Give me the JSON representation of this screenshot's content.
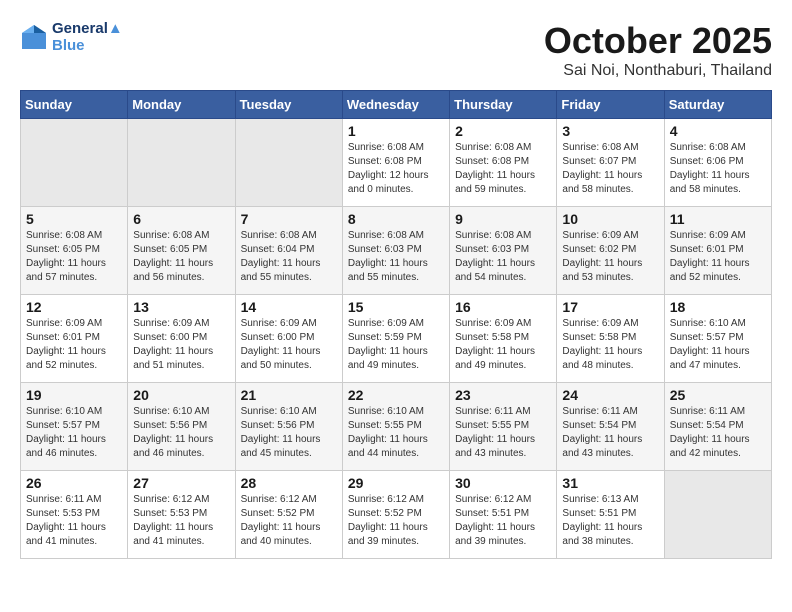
{
  "header": {
    "logo_line1": "General",
    "logo_line2": "Blue",
    "month": "October 2025",
    "location": "Sai Noi, Nonthaburi, Thailand"
  },
  "weekdays": [
    "Sunday",
    "Monday",
    "Tuesday",
    "Wednesday",
    "Thursday",
    "Friday",
    "Saturday"
  ],
  "weeks": [
    [
      {
        "day": "",
        "info": ""
      },
      {
        "day": "",
        "info": ""
      },
      {
        "day": "",
        "info": ""
      },
      {
        "day": "1",
        "info": "Sunrise: 6:08 AM\nSunset: 6:08 PM\nDaylight: 12 hours\nand 0 minutes."
      },
      {
        "day": "2",
        "info": "Sunrise: 6:08 AM\nSunset: 6:08 PM\nDaylight: 11 hours\nand 59 minutes."
      },
      {
        "day": "3",
        "info": "Sunrise: 6:08 AM\nSunset: 6:07 PM\nDaylight: 11 hours\nand 58 minutes."
      },
      {
        "day": "4",
        "info": "Sunrise: 6:08 AM\nSunset: 6:06 PM\nDaylight: 11 hours\nand 58 minutes."
      }
    ],
    [
      {
        "day": "5",
        "info": "Sunrise: 6:08 AM\nSunset: 6:05 PM\nDaylight: 11 hours\nand 57 minutes."
      },
      {
        "day": "6",
        "info": "Sunrise: 6:08 AM\nSunset: 6:05 PM\nDaylight: 11 hours\nand 56 minutes."
      },
      {
        "day": "7",
        "info": "Sunrise: 6:08 AM\nSunset: 6:04 PM\nDaylight: 11 hours\nand 55 minutes."
      },
      {
        "day": "8",
        "info": "Sunrise: 6:08 AM\nSunset: 6:03 PM\nDaylight: 11 hours\nand 55 minutes."
      },
      {
        "day": "9",
        "info": "Sunrise: 6:08 AM\nSunset: 6:03 PM\nDaylight: 11 hours\nand 54 minutes."
      },
      {
        "day": "10",
        "info": "Sunrise: 6:09 AM\nSunset: 6:02 PM\nDaylight: 11 hours\nand 53 minutes."
      },
      {
        "day": "11",
        "info": "Sunrise: 6:09 AM\nSunset: 6:01 PM\nDaylight: 11 hours\nand 52 minutes."
      }
    ],
    [
      {
        "day": "12",
        "info": "Sunrise: 6:09 AM\nSunset: 6:01 PM\nDaylight: 11 hours\nand 52 minutes."
      },
      {
        "day": "13",
        "info": "Sunrise: 6:09 AM\nSunset: 6:00 PM\nDaylight: 11 hours\nand 51 minutes."
      },
      {
        "day": "14",
        "info": "Sunrise: 6:09 AM\nSunset: 6:00 PM\nDaylight: 11 hours\nand 50 minutes."
      },
      {
        "day": "15",
        "info": "Sunrise: 6:09 AM\nSunset: 5:59 PM\nDaylight: 11 hours\nand 49 minutes."
      },
      {
        "day": "16",
        "info": "Sunrise: 6:09 AM\nSunset: 5:58 PM\nDaylight: 11 hours\nand 49 minutes."
      },
      {
        "day": "17",
        "info": "Sunrise: 6:09 AM\nSunset: 5:58 PM\nDaylight: 11 hours\nand 48 minutes."
      },
      {
        "day": "18",
        "info": "Sunrise: 6:10 AM\nSunset: 5:57 PM\nDaylight: 11 hours\nand 47 minutes."
      }
    ],
    [
      {
        "day": "19",
        "info": "Sunrise: 6:10 AM\nSunset: 5:57 PM\nDaylight: 11 hours\nand 46 minutes."
      },
      {
        "day": "20",
        "info": "Sunrise: 6:10 AM\nSunset: 5:56 PM\nDaylight: 11 hours\nand 46 minutes."
      },
      {
        "day": "21",
        "info": "Sunrise: 6:10 AM\nSunset: 5:56 PM\nDaylight: 11 hours\nand 45 minutes."
      },
      {
        "day": "22",
        "info": "Sunrise: 6:10 AM\nSunset: 5:55 PM\nDaylight: 11 hours\nand 44 minutes."
      },
      {
        "day": "23",
        "info": "Sunrise: 6:11 AM\nSunset: 5:55 PM\nDaylight: 11 hours\nand 43 minutes."
      },
      {
        "day": "24",
        "info": "Sunrise: 6:11 AM\nSunset: 5:54 PM\nDaylight: 11 hours\nand 43 minutes."
      },
      {
        "day": "25",
        "info": "Sunrise: 6:11 AM\nSunset: 5:54 PM\nDaylight: 11 hours\nand 42 minutes."
      }
    ],
    [
      {
        "day": "26",
        "info": "Sunrise: 6:11 AM\nSunset: 5:53 PM\nDaylight: 11 hours\nand 41 minutes."
      },
      {
        "day": "27",
        "info": "Sunrise: 6:12 AM\nSunset: 5:53 PM\nDaylight: 11 hours\nand 41 minutes."
      },
      {
        "day": "28",
        "info": "Sunrise: 6:12 AM\nSunset: 5:52 PM\nDaylight: 11 hours\nand 40 minutes."
      },
      {
        "day": "29",
        "info": "Sunrise: 6:12 AM\nSunset: 5:52 PM\nDaylight: 11 hours\nand 39 minutes."
      },
      {
        "day": "30",
        "info": "Sunrise: 6:12 AM\nSunset: 5:51 PM\nDaylight: 11 hours\nand 39 minutes."
      },
      {
        "day": "31",
        "info": "Sunrise: 6:13 AM\nSunset: 5:51 PM\nDaylight: 11 hours\nand 38 minutes."
      },
      {
        "day": "",
        "info": ""
      }
    ]
  ]
}
